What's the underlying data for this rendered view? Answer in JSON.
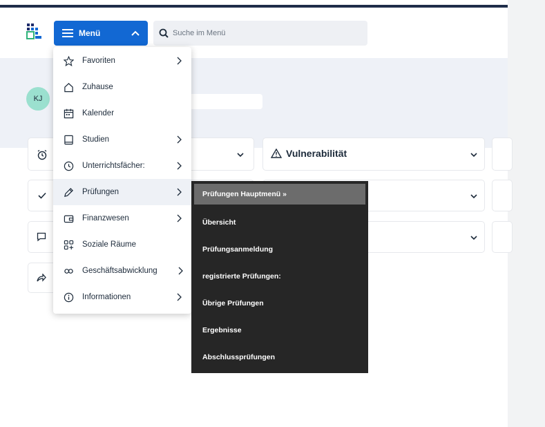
{
  "header": {
    "menu_label": "Menü",
    "search_placeholder": "Suche im Menü",
    "menu_hamburger_icon": "hamburger-icon",
    "menu_chevron_icon": "chevron-up-icon",
    "search_icon": "search-icon",
    "logo_icon": "app-logo",
    "accent_color": "#1268d3"
  },
  "profile": {
    "initials": "KJ",
    "avatar_color": "#9be0cf"
  },
  "dashboard": {
    "vulnerability_title": "Vulnerabilität",
    "warning_icon": "warning-triangle-icon",
    "row_icons": [
      "alarm-clock-icon",
      "check-icon",
      "chat-icon",
      "share-icon"
    ]
  },
  "menu": {
    "items": [
      {
        "label": "Favoriten",
        "icon": "star-icon",
        "has_submenu": true
      },
      {
        "label": "Zuhause",
        "icon": "home-icon",
        "has_submenu": false
      },
      {
        "label": "Kalender",
        "icon": "calendar-icon",
        "has_submenu": false
      },
      {
        "label": "Studien",
        "icon": "book-icon",
        "has_submenu": true
      },
      {
        "label": "Unterrichtsfächer:",
        "icon": "clock-icon",
        "has_submenu": true
      },
      {
        "label": "Prüfungen",
        "icon": "pencil-icon",
        "has_submenu": true
      },
      {
        "label": "Finanzwesen",
        "icon": "wallet-icon",
        "has_submenu": true
      },
      {
        "label": "Soziale Räume",
        "icon": "grid-plus-icon",
        "has_submenu": false
      },
      {
        "label": "Geschäftsabwicklung",
        "icon": "link-icon",
        "has_submenu": true
      },
      {
        "label": "Informationen",
        "icon": "info-icon",
        "has_submenu": true
      }
    ],
    "active_item": "Prüfungen"
  },
  "submenu": {
    "items": [
      "Prüfungen Hauptmenü »",
      "Übersicht",
      "Prüfungsanmeldung",
      "registrierte Prüfungen:",
      "Übrige Prüfungen",
      "Ergebnisse",
      "Abschlussprüfungen"
    ],
    "highlight_color": "#6c6c6c",
    "background_color": "#262626"
  }
}
